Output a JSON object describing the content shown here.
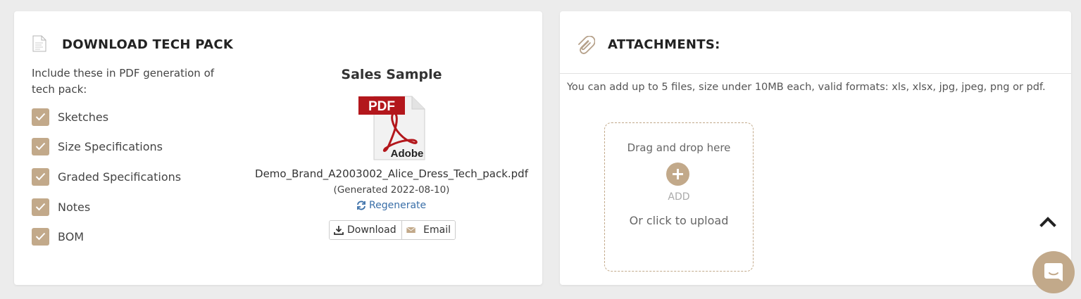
{
  "tech_pack": {
    "title": "DOWNLOAD TECH PACK",
    "intro": "Include these in PDF generation of tech pack:",
    "options": [
      {
        "label": "Sketches",
        "checked": true
      },
      {
        "label": "Size Specifications",
        "checked": true
      },
      {
        "label": "Graded Specifications",
        "checked": true
      },
      {
        "label": "Notes",
        "checked": true
      },
      {
        "label": "BOM",
        "checked": true
      }
    ],
    "sample_title": "Sales Sample",
    "pdf_icon": {
      "badge": "PDF",
      "brand": "Adobe"
    },
    "file_name": "Demo_Brand_A2003002_Alice_Dress_Tech_pack.pdf",
    "generated": "(Generated 2022-08-10)",
    "regenerate_label": "Regenerate",
    "download_label": "Download",
    "email_label": "Email"
  },
  "attachments": {
    "title": "ATTACHMENTS:",
    "info": "You can add up to 5 files, size under 10MB each, valid formats: xls, xlsx, jpg, jpeg, png or pdf.",
    "dropzone": {
      "top_text": "Drag and drop here",
      "add_label": "ADD",
      "bottom_text": "Or click to upload"
    }
  },
  "colors": {
    "accent": "#c2a98a",
    "link": "#3a6fa8",
    "background": "#ececec"
  }
}
